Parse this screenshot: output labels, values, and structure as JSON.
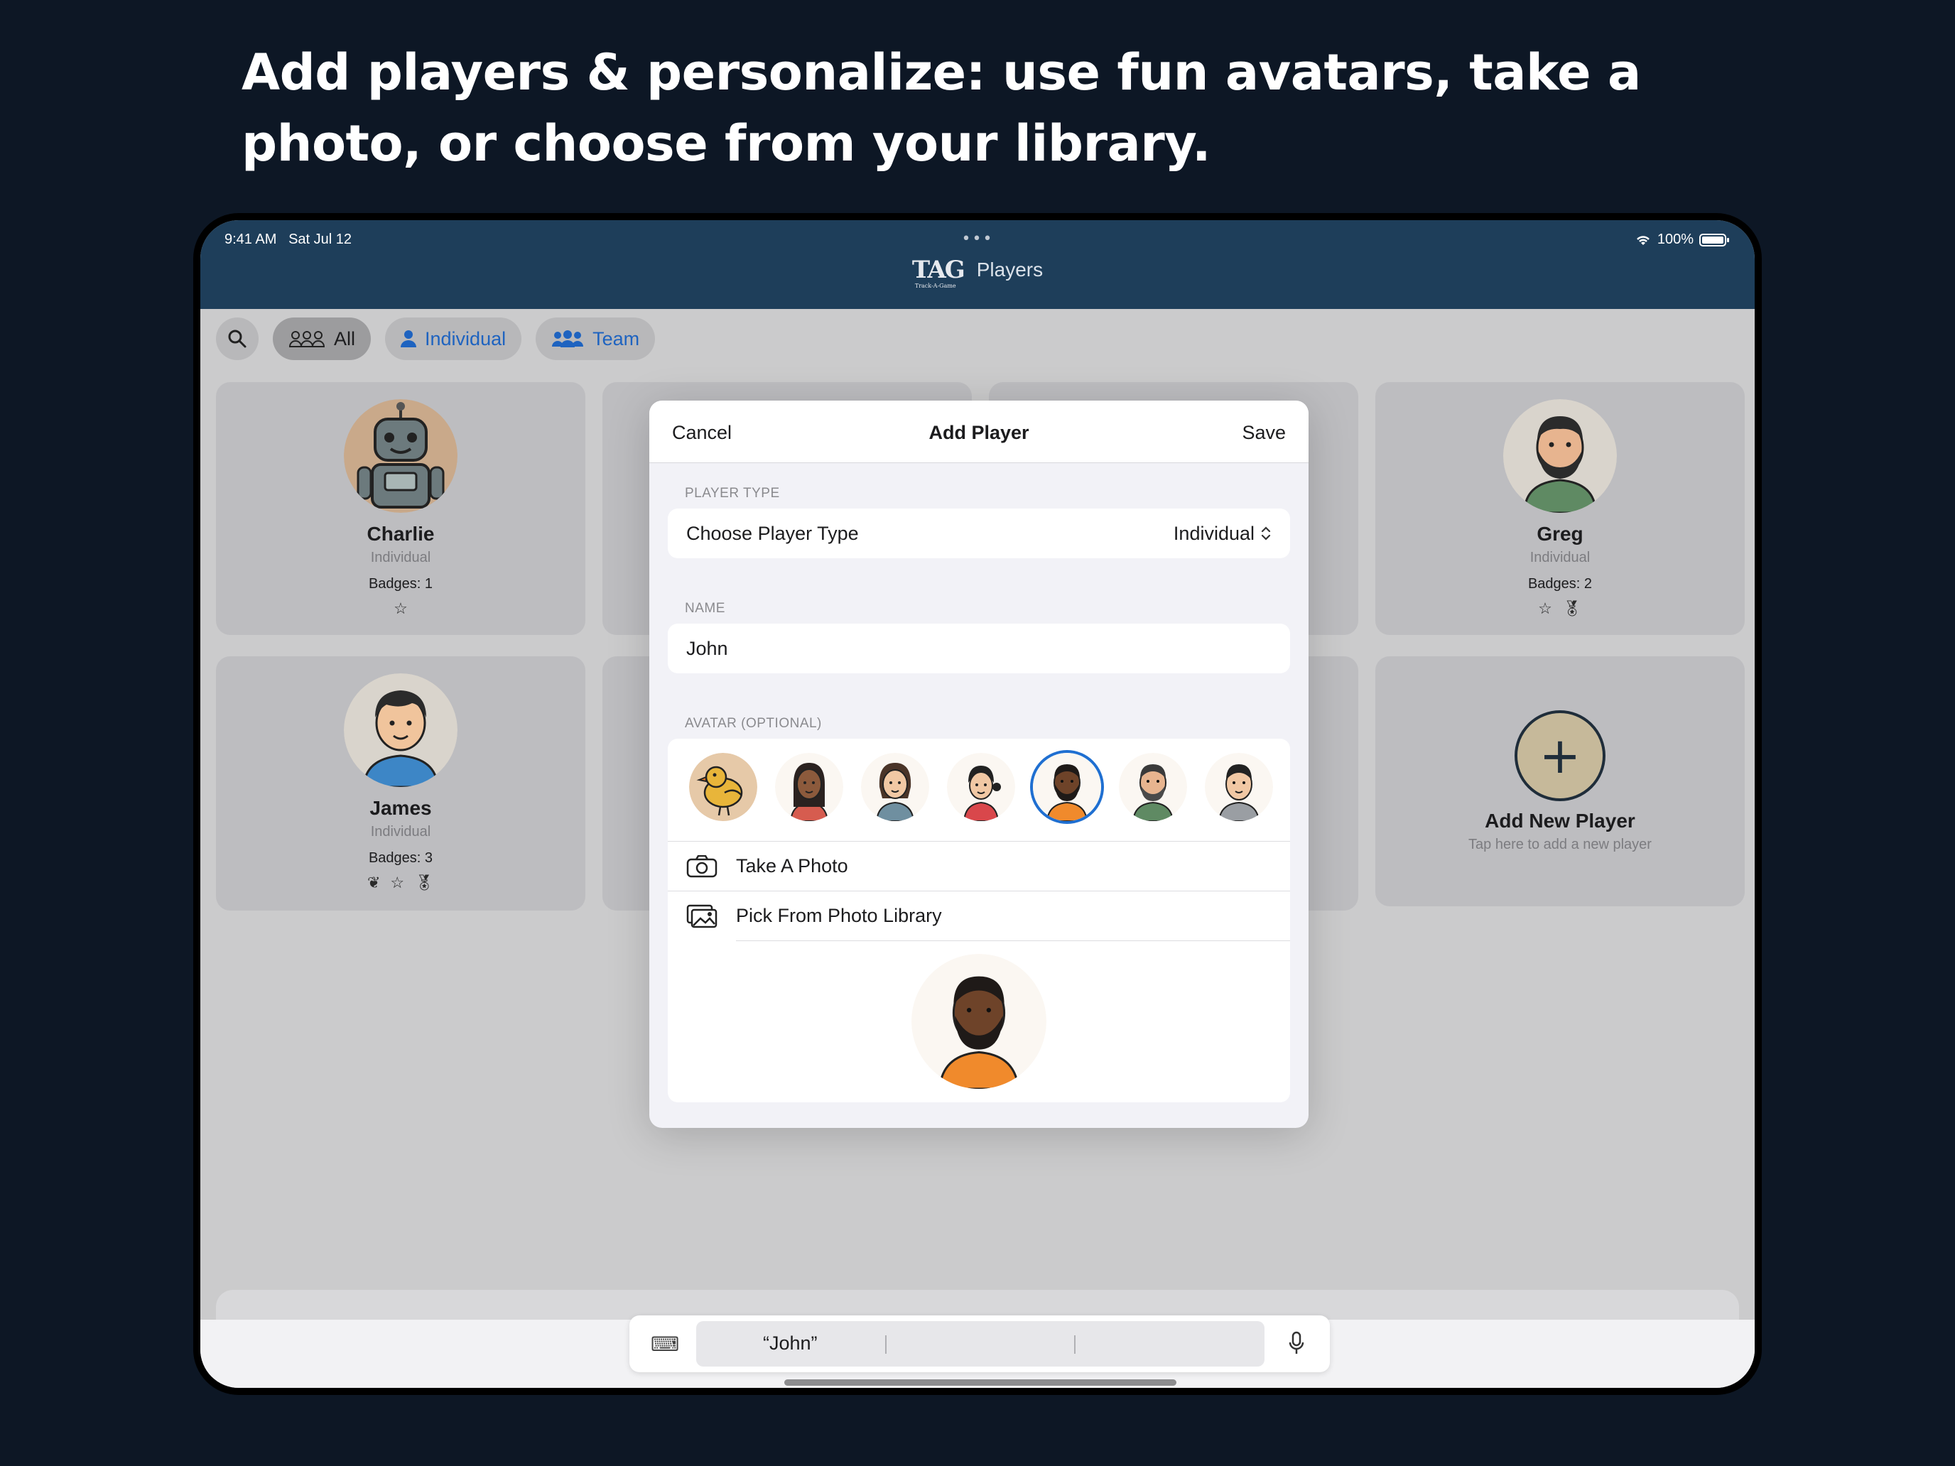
{
  "headline": "Add players & personalize: use fun avatars, take a photo, or choose from your library.",
  "status": {
    "time": "9:41 AM",
    "date": "Sat Jul 12",
    "battery": "100%"
  },
  "nav": {
    "logo": "TAG",
    "logo_sub": "Track-A-Game",
    "title": "Players"
  },
  "filters": {
    "all": "All",
    "individual": "Individual",
    "team": "Team"
  },
  "players": [
    {
      "name": "Charlie",
      "type": "Individual",
      "badges": "Badges: 1"
    },
    {
      "name": "Greg",
      "type": "Individual",
      "badges": "Badges: 2"
    },
    {
      "name": "James",
      "type": "Individual",
      "badges": "Badges: 3"
    }
  ],
  "add_player_card": {
    "plus": "+",
    "title": "Add New Player",
    "subtitle": "Tap here to add a new player"
  },
  "modal": {
    "cancel": "Cancel",
    "title": "Add Player",
    "save": "Save",
    "player_type_header": "PLAYER TYPE",
    "player_type_label": "Choose Player Type",
    "player_type_value": "Individual",
    "name_header": "NAME",
    "name_value": "John",
    "avatar_header": "AVATAR (OPTIONAL)",
    "take_photo": "Take A Photo",
    "pick_library": "Pick From Photo Library"
  },
  "keyboard": {
    "suggestion": "“John”"
  },
  "colors": {
    "navbar": "#1e3e5a",
    "accent": "#1e63c0",
    "background": "#0d1725",
    "selected_ring": "#1f6fd1"
  }
}
